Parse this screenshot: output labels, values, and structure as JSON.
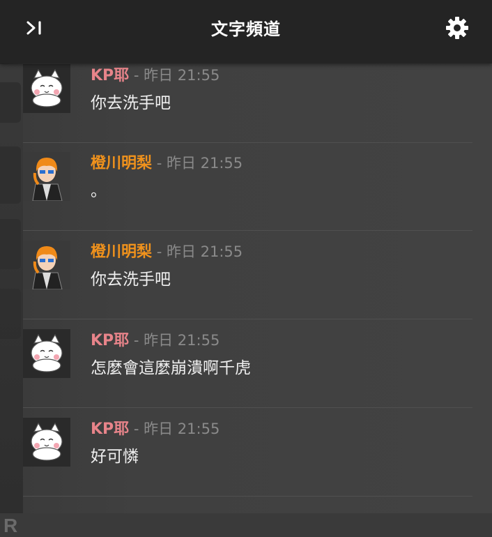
{
  "header": {
    "title": "文字頻道",
    "collapse_icon": "panel-collapse-icon",
    "settings_icon": "gear-icon"
  },
  "colors": {
    "header_bg": "#242424",
    "kp_name": "#e8848a",
    "orange_name": "#f0921c",
    "timestamp": "#8a8a8a",
    "message_text": "#f0f0f0"
  },
  "messages": [
    {
      "author": "KP耶",
      "separator": " - ",
      "time": "昨日 21:55",
      "text": "你去洗手吧",
      "avatar": "white-cat-avatar"
    },
    {
      "author": "橙川明梨",
      "separator": " - ",
      "time": "昨日 21:55",
      "text": "。",
      "avatar": "orange-hair-character-avatar"
    },
    {
      "author": "橙川明梨",
      "separator": " - ",
      "time": "昨日 21:55",
      "text": "你去洗手吧",
      "avatar": "orange-hair-character-avatar"
    },
    {
      "author": "KP耶",
      "separator": " - ",
      "time": "昨日 21:55",
      "text": "怎麼會這麼崩潰啊千虎",
      "avatar": "white-cat-avatar"
    },
    {
      "author": "KP耶",
      "separator": " - ",
      "time": "昨日 21:55",
      "text": "好可憐",
      "avatar": "white-cat-avatar"
    }
  ]
}
